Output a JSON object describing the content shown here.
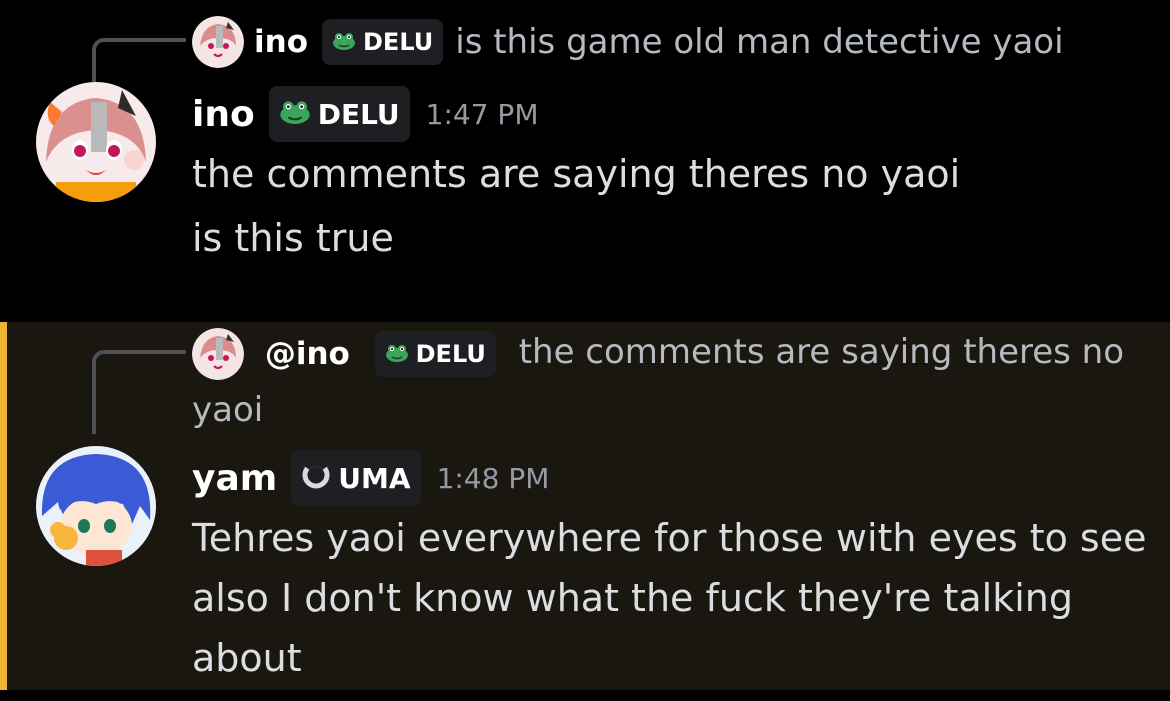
{
  "messages": [
    {
      "reply": {
        "name": "ino",
        "tag": "DELU",
        "text": "is this game old man detective yaoi"
      },
      "author": "ino",
      "tag": "DELU",
      "time": "1:47 PM",
      "lines": [
        "the comments are saying theres no yaoi",
        "is this true"
      ]
    },
    {
      "highlighted": true,
      "reply": {
        "name": "@ino",
        "tag": "DELU",
        "text_line1": "the comments are saying theres no",
        "text_line2": "yaoi"
      },
      "author": "yam",
      "tag": "UMA",
      "time": "1:48 PM",
      "lines": [
        "Tehres yaoi everywhere for those with eyes to see",
        "also I don't know what the fuck they're talking",
        "about"
      ]
    }
  ],
  "icons": {
    "delu_tag": "frog-icon",
    "uma_tag": "ring-icon"
  },
  "colors": {
    "mention_bar": "#f0b232",
    "highlight_bg": "#1a1610",
    "frog_green": "#3ba55c"
  }
}
